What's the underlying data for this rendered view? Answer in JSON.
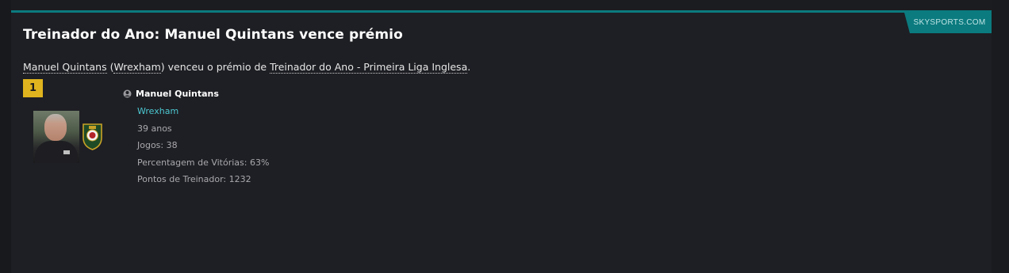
{
  "article": {
    "source": "SKYSPORTS.COM",
    "title": "Treinador do Ano: Manuel Quintans vence prémio",
    "summary": {
      "manager_link": "Manuel Quintans",
      "open_paren": " (",
      "club_link": "Wrexham",
      "middle": ") venceu o prémio de ",
      "award_link": "Treinador do Ano - Primeira Liga Inglesa",
      "end": "."
    }
  },
  "winner": {
    "rank": "1",
    "name": "Manuel Quintans",
    "club": "Wrexham",
    "age": "39 anos",
    "games": "Jogos: 38",
    "win_percentage": "Percentagem de Vitórias: 63%",
    "manager_points": "Pontos de Treinador: 1232"
  },
  "colors": {
    "accent": "#0b7b7f",
    "rank_badge": "#e0b41e",
    "club_link": "#4cc7d1",
    "background": "#1e1f24"
  },
  "icons": {
    "person": "person-icon",
    "crest": "club-crest-icon"
  }
}
